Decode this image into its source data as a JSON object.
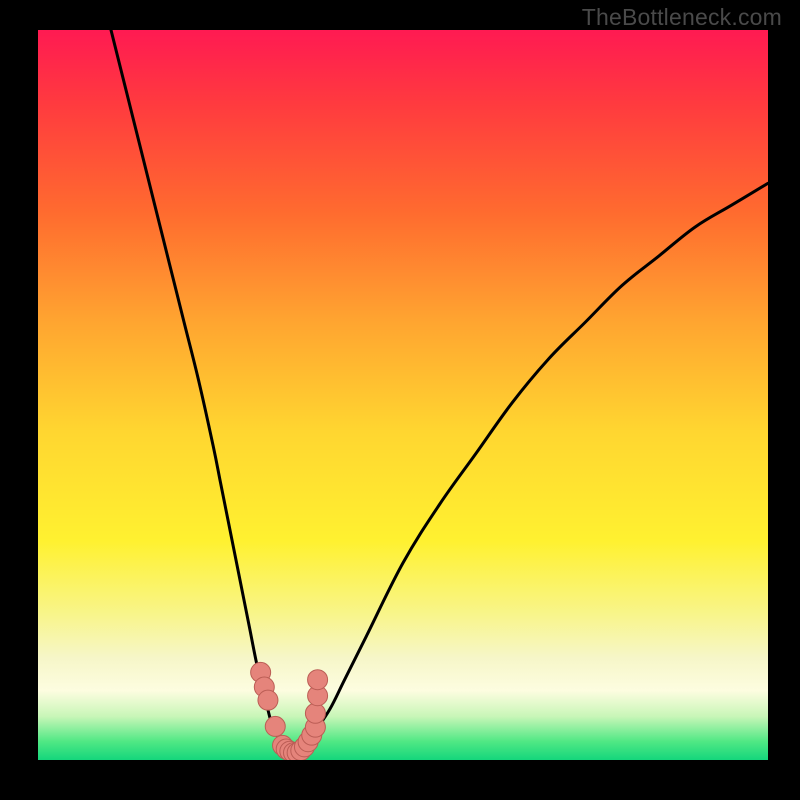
{
  "watermark": "TheBottleneck.com",
  "colors": {
    "background": "#000000",
    "curve": "#000000",
    "marker_fill": "#e5847b",
    "marker_stroke": "#bb5d55"
  },
  "gradient_stops": [
    {
      "offset": 0.0,
      "color": "#ff1a52"
    },
    {
      "offset": 0.1,
      "color": "#ff3a3f"
    },
    {
      "offset": 0.25,
      "color": "#ff6b2f"
    },
    {
      "offset": 0.4,
      "color": "#ffa530"
    },
    {
      "offset": 0.55,
      "color": "#ffd630"
    },
    {
      "offset": 0.7,
      "color": "#fff130"
    },
    {
      "offset": 0.8,
      "color": "#f8f58a"
    },
    {
      "offset": 0.86,
      "color": "#f6f6c8"
    },
    {
      "offset": 0.905,
      "color": "#fdfde0"
    },
    {
      "offset": 0.94,
      "color": "#c9f6b8"
    },
    {
      "offset": 0.975,
      "color": "#4fe884"
    },
    {
      "offset": 1.0,
      "color": "#14d67c"
    }
  ],
  "chart_data": {
    "type": "line",
    "title": "",
    "xlabel": "",
    "ylabel": "",
    "xlim": [
      0,
      100
    ],
    "ylim": [
      0,
      100
    ],
    "series": [
      {
        "name": "left-branch",
        "x": [
          10,
          12,
          14,
          16,
          18,
          20,
          22,
          24,
          25,
          26,
          27,
          28,
          29,
          30,
          31,
          32,
          33,
          34,
          35
        ],
        "y": [
          100,
          92,
          84,
          76,
          68,
          60,
          52,
          43,
          38,
          33,
          28,
          23,
          18,
          13,
          9,
          5,
          3,
          1.5,
          1
        ]
      },
      {
        "name": "right-branch",
        "x": [
          35,
          36,
          37,
          38,
          40,
          42,
          45,
          50,
          55,
          60,
          65,
          70,
          75,
          80,
          85,
          90,
          95,
          100
        ],
        "y": [
          1,
          1.5,
          2.5,
          4,
          7,
          11,
          17,
          27,
          35,
          42,
          49,
          55,
          60,
          65,
          69,
          73,
          76,
          79
        ]
      }
    ],
    "markers": {
      "name": "highlight-points",
      "x": [
        30.5,
        31.0,
        31.5,
        32.5,
        33.5,
        34.0,
        34.5,
        35.0,
        35.5,
        36.0,
        36.5,
        37.0,
        37.5,
        38.0,
        38.0,
        38.3,
        38.3
      ],
      "y": [
        12.0,
        10.0,
        8.2,
        4.6,
        2.0,
        1.5,
        1.2,
        1.0,
        1.0,
        1.3,
        1.8,
        2.5,
        3.4,
        4.5,
        6.4,
        8.8,
        11.0
      ]
    }
  }
}
